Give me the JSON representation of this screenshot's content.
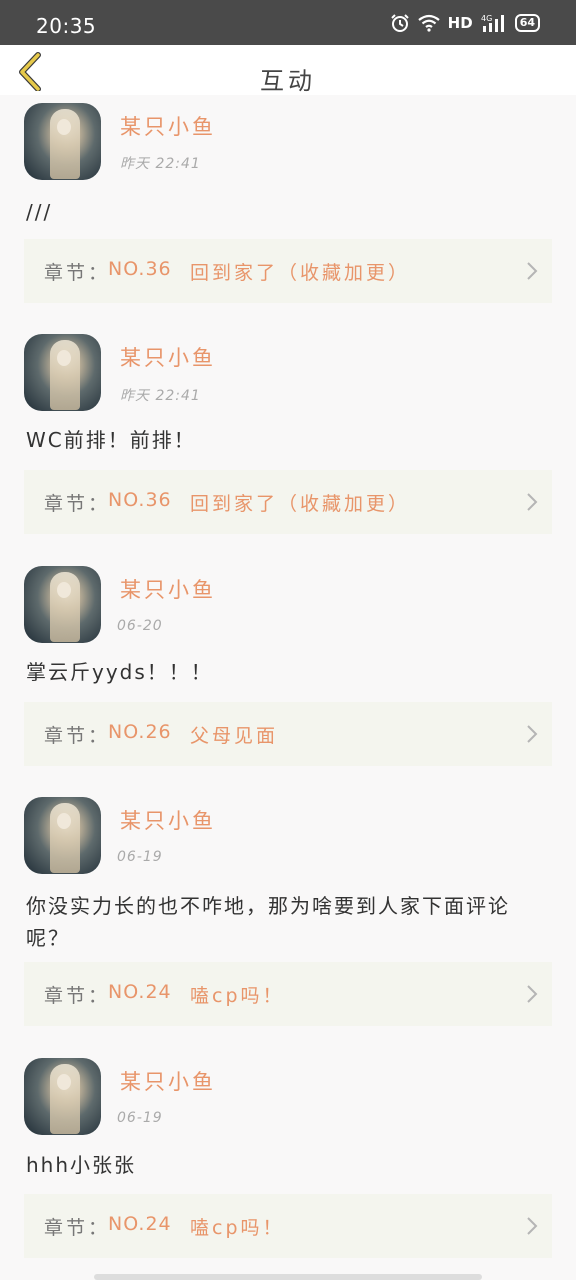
{
  "status_bar": {
    "time": "20:35",
    "network": "HD",
    "signal_label": "4G",
    "battery": "64"
  },
  "header": {
    "title": "互动"
  },
  "comments": [
    {
      "username": "某只小鱼",
      "time": "昨天 22:41",
      "content": "///",
      "chapter_prefix": "章节：",
      "chapter_no": "NO.36",
      "chapter_title": "回到家了（收藏加更）"
    },
    {
      "username": "某只小鱼",
      "time": "昨天 22:41",
      "content": "WC前排！前排！",
      "chapter_prefix": "章节：",
      "chapter_no": "NO.36",
      "chapter_title": "回到家了（收藏加更）"
    },
    {
      "username": "某只小鱼",
      "time": "06-20",
      "content": "掌云斤yyds！！！",
      "chapter_prefix": "章节：",
      "chapter_no": "NO.26",
      "chapter_title": "父母见面"
    },
    {
      "username": "某只小鱼",
      "time": "06-19",
      "content": "你没实力长的也不咋地，那为啥要到人家下面评论呢？",
      "chapter_prefix": "章节：",
      "chapter_no": "NO.24",
      "chapter_title": "嗑cp吗！"
    },
    {
      "username": "某只小鱼",
      "time": "06-19",
      "content": "hhh小张张",
      "chapter_prefix": "章节：",
      "chapter_no": "NO.24",
      "chapter_title": "嗑cp吗！"
    }
  ],
  "colors": {
    "accent": "#e8956a",
    "chapter_bg": "#f4f5ee",
    "status_bar": "#4a4a4a",
    "back_icon": "#e6c94a"
  },
  "icons": {
    "back": "back-chevron-icon",
    "chapter": "chevron-right-icon",
    "alarm": "alarm-icon",
    "wifi": "wifi-icon",
    "signal": "signal-icon",
    "battery": "battery-icon"
  }
}
